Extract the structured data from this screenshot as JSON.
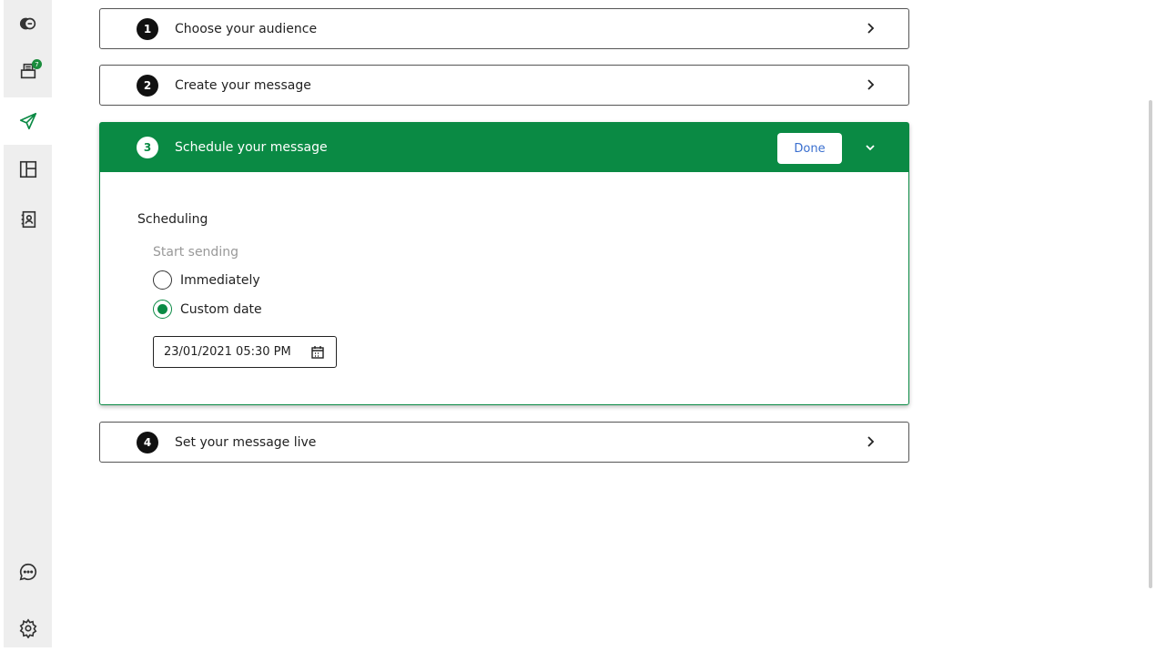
{
  "sidebar": {
    "items": [
      {
        "name": "conversations"
      },
      {
        "name": "inbox",
        "badge": "7"
      },
      {
        "name": "send",
        "active": true
      },
      {
        "name": "layout"
      },
      {
        "name": "contacts"
      },
      {
        "name": "chat"
      },
      {
        "name": "settings"
      }
    ]
  },
  "steps": [
    {
      "number": "1",
      "title": "Choose your audience"
    },
    {
      "number": "2",
      "title": "Create your message"
    },
    {
      "number": "3",
      "title": "Schedule your message",
      "done_label": "Done"
    },
    {
      "number": "4",
      "title": "Set your message live"
    }
  ],
  "schedule": {
    "section_label": "Scheduling",
    "start_label": "Start sending",
    "options": [
      "Immediately",
      "Custom date"
    ],
    "selected": "Custom date",
    "date_value": "23/01/2021 05:30 PM"
  },
  "colors": {
    "accent": "#0a8a44",
    "link": "#3a6fcf"
  }
}
